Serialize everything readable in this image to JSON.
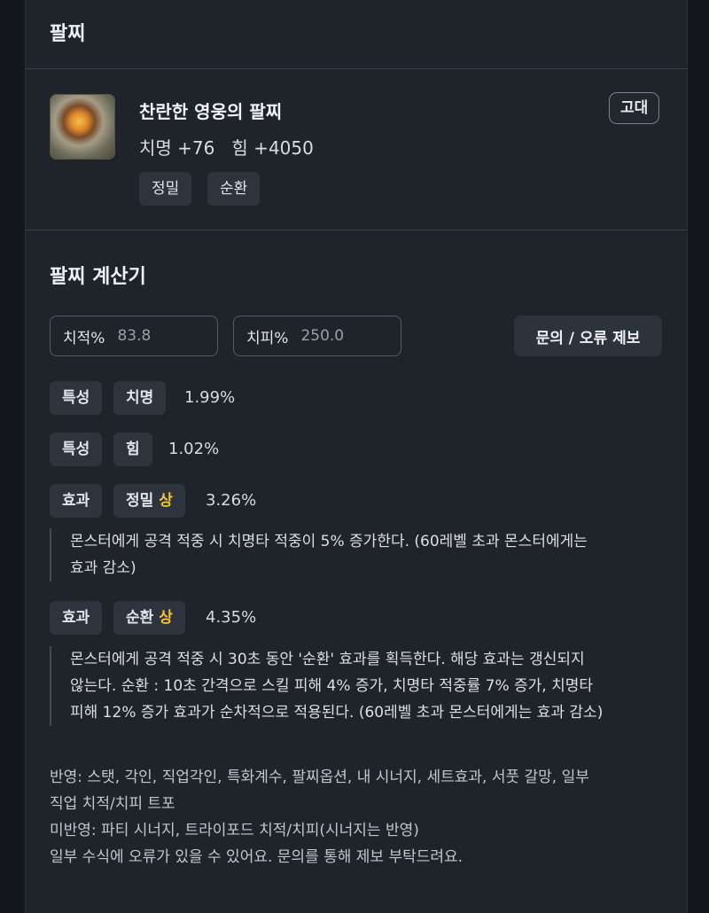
{
  "header": {
    "title": "팔찌"
  },
  "item": {
    "name": "찬란한 영웅의 팔찌",
    "stats": "치명 +76   힘 +4050",
    "grade": "고대",
    "tags": [
      "정밀",
      "순환"
    ]
  },
  "calculator": {
    "title": "팔찌 계산기",
    "crit_rate": {
      "label": "치적%",
      "value": "83.8"
    },
    "crit_damage": {
      "label": "치피%",
      "value": "250.0"
    },
    "report_button": "문의 / 오류 제보",
    "rows": [
      {
        "type": "특성",
        "name": "치명",
        "grade": "",
        "value": "1.99%"
      },
      {
        "type": "특성",
        "name": "힘",
        "grade": "",
        "value": "1.02%"
      },
      {
        "type": "효과",
        "name": "정밀",
        "grade": "상",
        "value": "3.26%",
        "desc_lines": [
          "몬스터에게 공격 적중 시 치명타 적중이 5% 증가한다. (60레벨 초과 몬스터에게는",
          "효과 감소)"
        ]
      },
      {
        "type": "효과",
        "name": "순환",
        "grade": "상",
        "value": "4.35%",
        "desc_lines": [
          "몬스터에게 공격 적중 시 30초 동안 '순환' 효과를 획득한다. 해당 효과는 갱신되지",
          "않는다. 순환 : 10초 간격으로 스킬 피해 4% 증가, 치명타 적중률 7% 증가, 치명타",
          "피해 12% 증가 효과가 순차적으로 적용된다. (60레벨 초과 몬스터에게는 효과 감소)"
        ]
      }
    ]
  },
  "notes": [
    "반영: 스탯, 각인, 직업각인, 특화계수, 팔찌옵션, 내 시너지, 세트효과, 서풋 갈망, 일부",
    "직업 치적/치피 트포",
    "미반영: 파티 시너지, 트라이포드 치적/치피(시너지는 반영)",
    "일부 수식에 오류가 있을 수 있어요. 문의를 통해 제보 부탁드려요."
  ],
  "colors": {
    "background": "#1f232a",
    "chip": "#2e343d",
    "grade_mark": "#f2c23a"
  },
  "icons": {
    "item": "bracelet-item-icon"
  }
}
